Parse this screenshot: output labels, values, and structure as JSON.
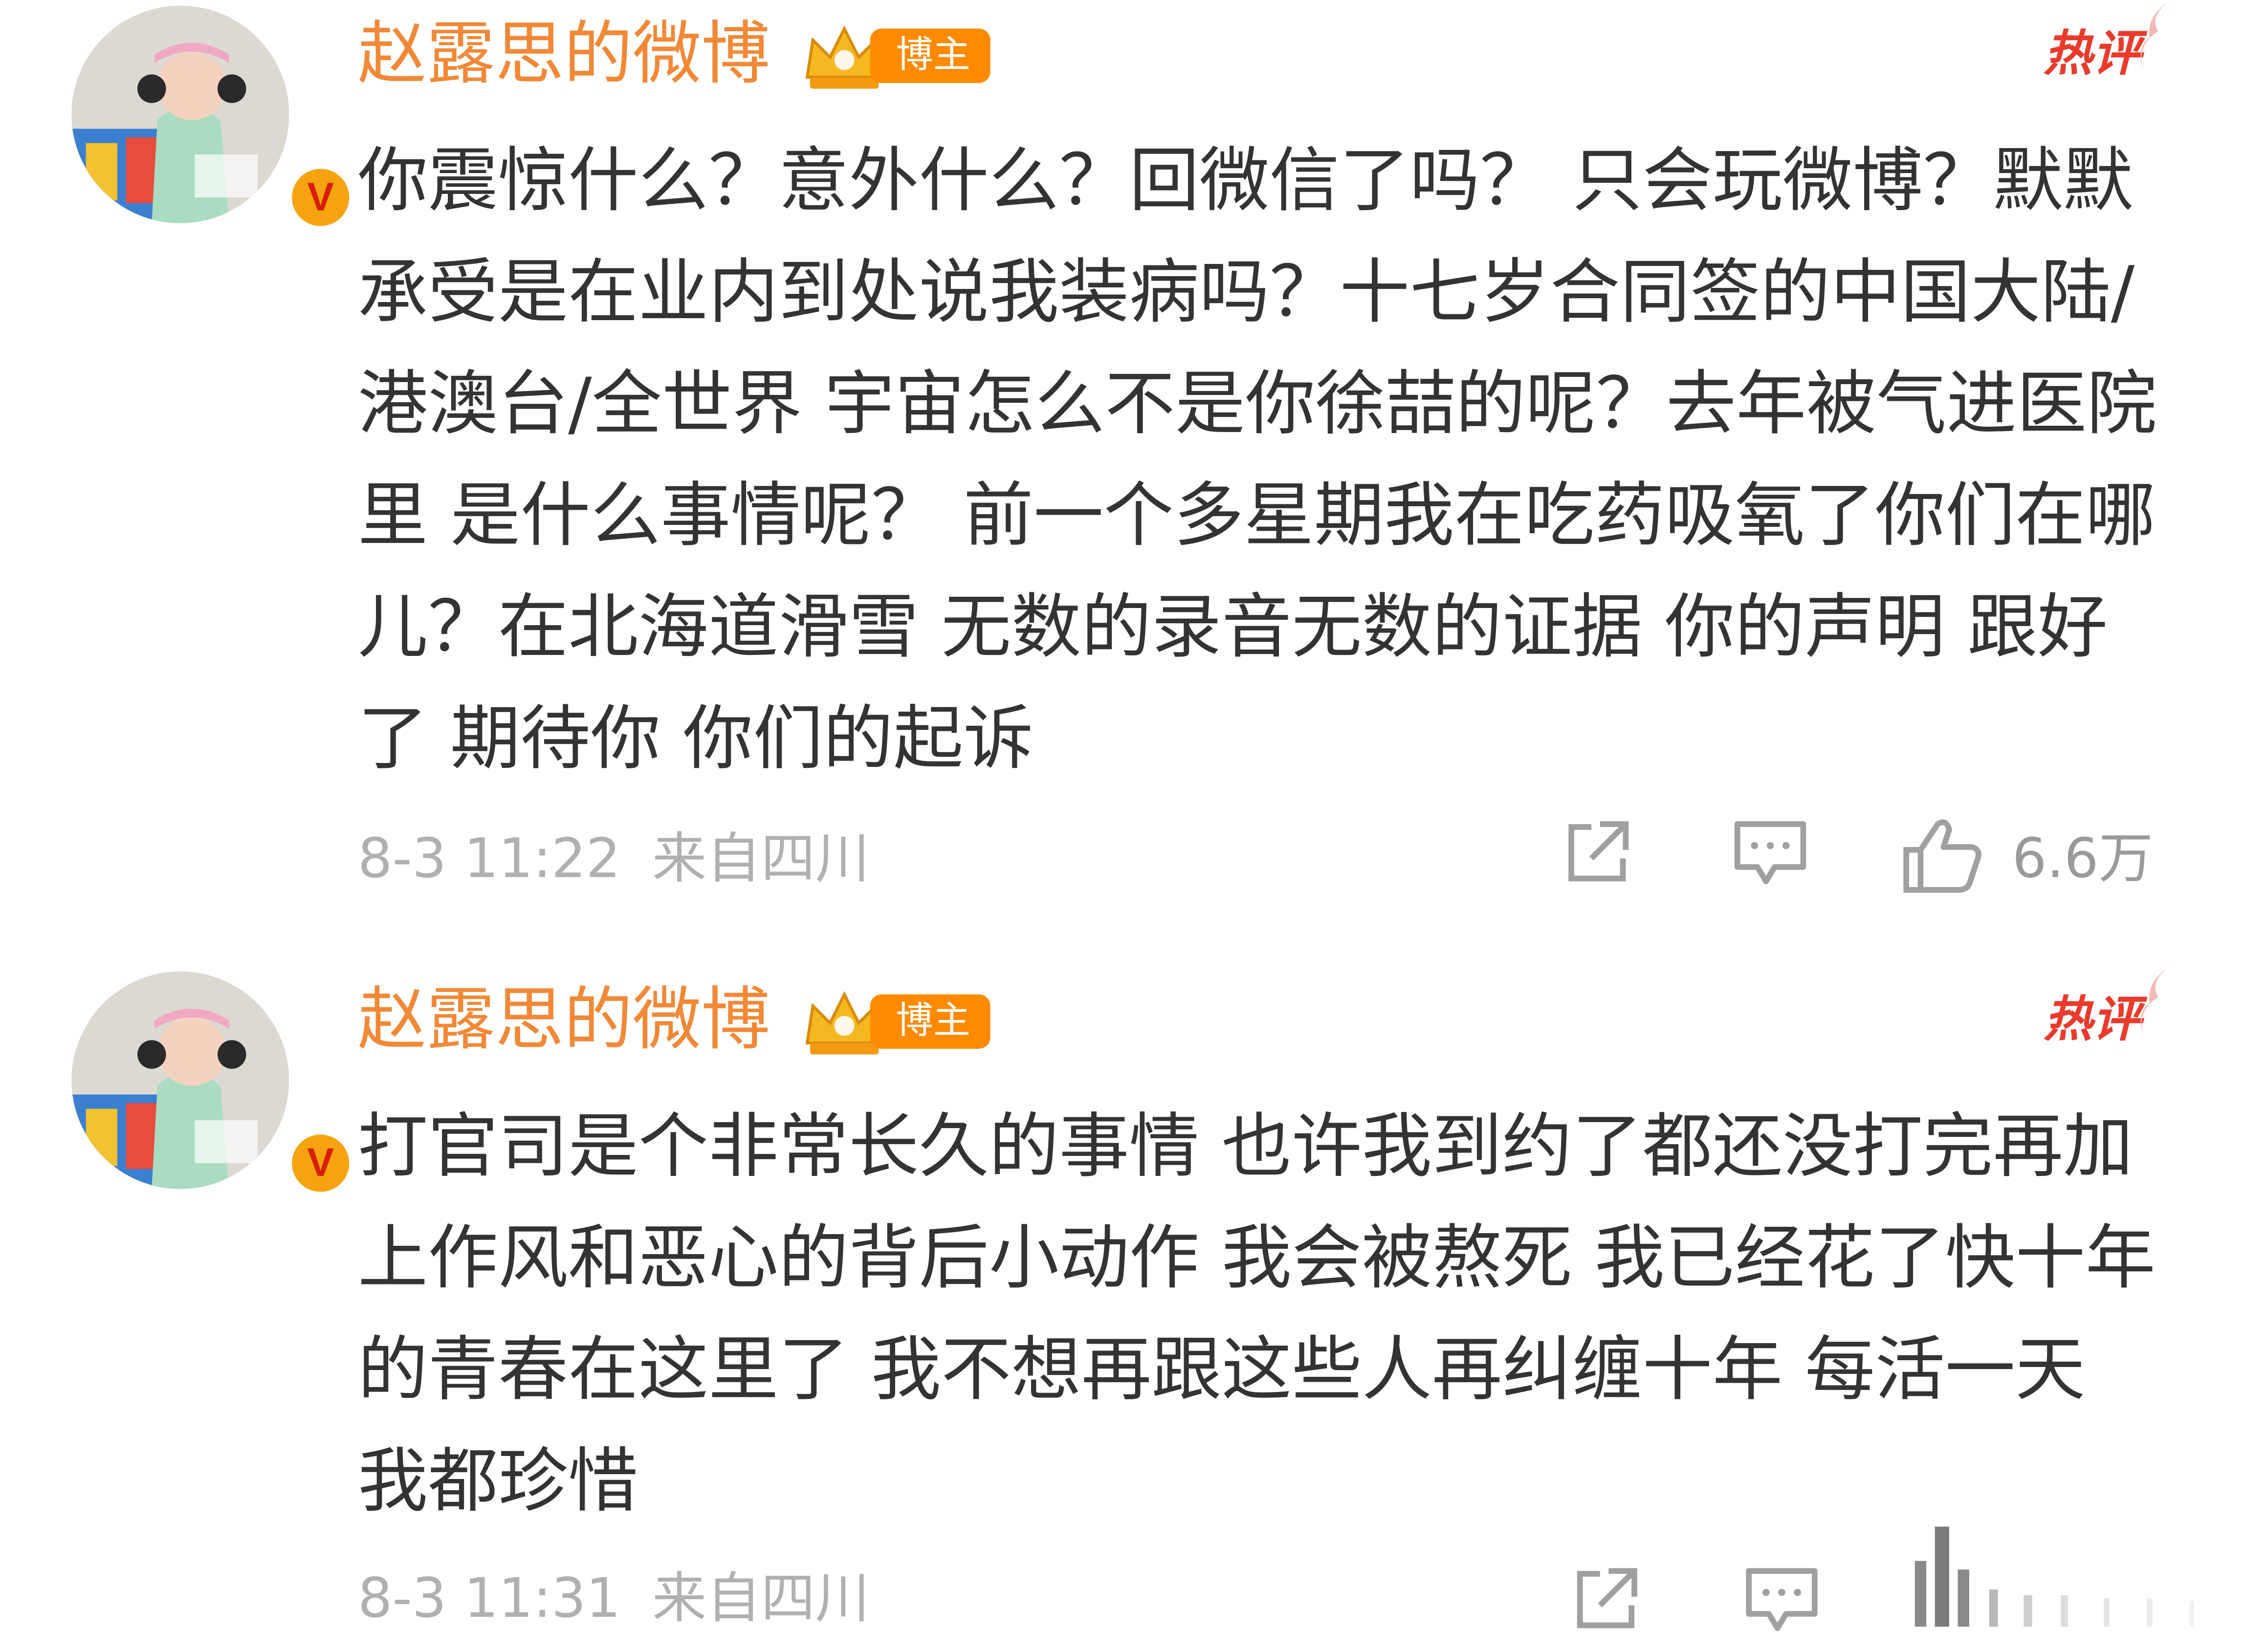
{
  "colors": {
    "username": "#f28836",
    "badge_orange": "#ff8a00",
    "hot_red": "#ea3a2c",
    "text": "#333333",
    "meta": "#b0b0b0",
    "icon": "#9a9a9a"
  },
  "comments": [
    {
      "username": "赵露思的微博",
      "badge_label": "博主",
      "hot_label": "热评",
      "verified_mark": "V",
      "text": "你震惊什么？意外什么？回微信了吗？ 只会玩微博？默默承受是在业内到处说我装病吗？十七岁合同签的中国大陆/港澳台/全世界 宇宙怎么不是你徐喆的呢？去年被气进医院里 是什么事情呢？ 前一个多星期我在吃药吸氧了你们在哪儿？在北海道滑雪 无数的录音无数的证据 你的声明 跟好了 期待你 你们的起诉",
      "time": "8-3 11:22",
      "location": "来自四川",
      "like_count": "6.6万",
      "icons": [
        "share-icon",
        "comment-icon",
        "like-icon"
      ]
    },
    {
      "username": "赵露思的微博",
      "badge_label": "博主",
      "hot_label": "热评",
      "verified_mark": "V",
      "text": "打官司是个非常长久的事情 也许我到约了都还没打完再加上作风和恶心的背后小动作 我会被熬死 我已经花了快十年的青春在这里了 我不想再跟这些人再纠缠十年 每活一天 我都珍惜",
      "time": "8-3 11:31",
      "location": "来自四川",
      "like_count": "",
      "icons": [
        "share-icon",
        "comment-icon",
        "like-icon"
      ]
    }
  ]
}
